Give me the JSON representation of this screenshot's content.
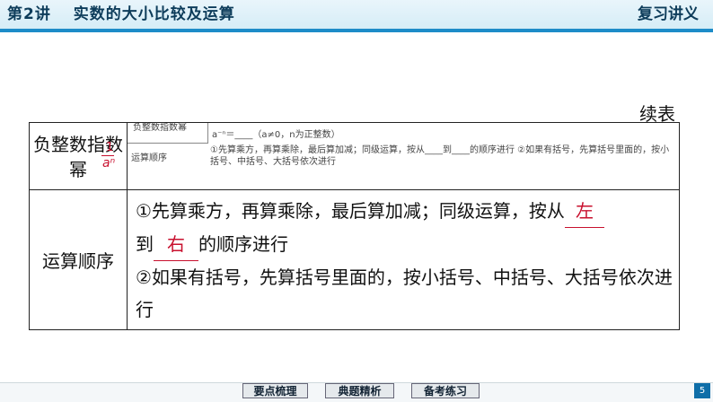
{
  "header": {
    "lesson_num": "第2讲",
    "lesson_title": "实数的大小比较及运算",
    "review_title": "复习讲义"
  },
  "continued": "续表",
  "table": {
    "row1_header": "负整数指数幂",
    "mini": {
      "cell1": "负整数指数幂",
      "formula": "a⁻ⁿ＝____（a≠0，n为正整数）",
      "label": "运算顺序",
      "text": "①先算乘方，再算乘除，最后算加减；同级运算，按从____到____的顺序进行 ②如果有括号，先算括号里面的，按小括号、中括号、大括号依次进行"
    },
    "frac": {
      "num": "1",
      "den": "aⁿ"
    },
    "row2_header": "运算顺序",
    "row2": {
      "l1": "①先算乘方，再算乘除，最后算加减；同级运算，按从",
      "ans1": "左",
      "l2a": "到",
      "ans2": "右",
      "l2b": "的顺序进行",
      "l3": "②如果有括号，先算括号里面的，按小括号、中括号、大括号依次进行"
    }
  },
  "footer": {
    "b1": "要点梳理",
    "b2": "典题精析",
    "b3": "备考练习",
    "page": "5"
  }
}
